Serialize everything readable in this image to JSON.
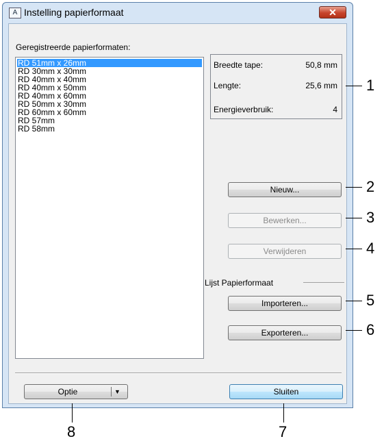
{
  "window": {
    "title": "Instelling papierformaat",
    "icon": "A",
    "close_glyph": "✕"
  },
  "list": {
    "label": "Geregistreerde papierformaten:",
    "items": [
      "RD 51mm x 26mm",
      "RD 30mm x 30mm",
      "RD 40mm x 40mm",
      "RD 40mm x 50mm",
      "RD 40mm x 60mm",
      "RD 50mm x 30mm",
      "RD 60mm x 60mm",
      "RD 57mm",
      "RD 58mm"
    ],
    "selected_index": 0
  },
  "info": {
    "width_label": "Breedte tape:",
    "width_value": "50,8 mm",
    "length_label": "Lengte:",
    "length_value": "25,6 mm",
    "energy_label": "Energieverbruik:",
    "energy_value": "4"
  },
  "buttons": {
    "new": "Nieuw...",
    "edit": "Bewerken...",
    "delete": "Verwijderen",
    "import": "Importeren...",
    "export": "Exporteren...",
    "option": "Optie",
    "close": "Sluiten"
  },
  "group_label": "Lijst Papierformaat",
  "callouts": [
    "1",
    "2",
    "3",
    "4",
    "5",
    "6",
    "7",
    "8"
  ]
}
